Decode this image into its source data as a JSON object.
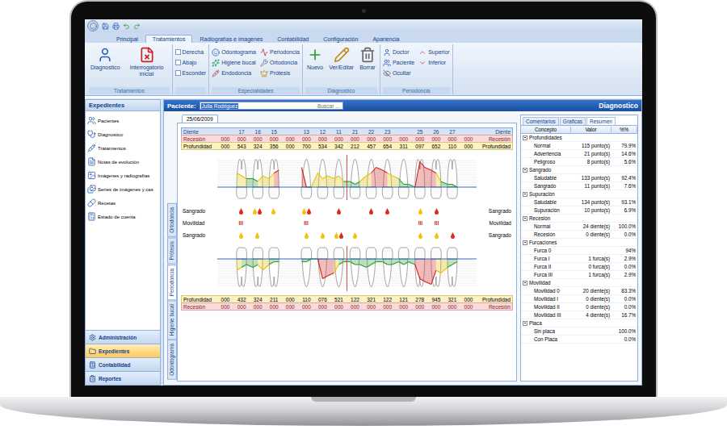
{
  "ribbon": {
    "tabs": [
      {
        "label": "Principal",
        "selected": false
      },
      {
        "label": "Tratamientos",
        "selected": true
      },
      {
        "label": "Radiografías e imágenes",
        "selected": false
      },
      {
        "label": "Contabilidad",
        "selected": false
      },
      {
        "label": "Configuración",
        "selected": false
      },
      {
        "label": "Apariencia",
        "selected": false
      }
    ],
    "groups": [
      {
        "label": "Tratamientos",
        "items": [
          {
            "label": "Diagnostico",
            "kind": "large"
          },
          {
            "label": "Interrogatorio inicial",
            "kind": "large"
          }
        ]
      },
      {
        "items": [
          {
            "label": "Derecha",
            "kind": "checkbox",
            "checked": false
          },
          {
            "label": "Abajo",
            "kind": "checkbox",
            "checked": false
          },
          {
            "label": "Esconder",
            "kind": "checkbox",
            "checked": false
          }
        ]
      },
      {
        "label": "Especialidades",
        "items": [
          {
            "label": "Odontograma",
            "kind": "small"
          },
          {
            "label": "Higiene bucal",
            "kind": "small"
          },
          {
            "label": "Endodoncia",
            "kind": "small"
          },
          {
            "label": "Periodoncia",
            "kind": "small"
          },
          {
            "label": "Ortodoncia",
            "kind": "small"
          },
          {
            "label": "Prótesis",
            "kind": "small"
          }
        ]
      },
      {
        "label": "Diagnostico",
        "items": [
          {
            "label": "Nuevo",
            "kind": "large"
          },
          {
            "label": "Ver/Editar",
            "kind": "large"
          },
          {
            "label": "Borrar",
            "kind": "large"
          }
        ]
      },
      {
        "label": "Periodoncia",
        "items": [
          {
            "label": "Doctor",
            "kind": "small"
          },
          {
            "label": "Paciente",
            "kind": "small"
          },
          {
            "label": "Ocultar",
            "kind": "small"
          },
          {
            "label": "Superior",
            "kind": "small"
          },
          {
            "label": "Inferior",
            "kind": "small"
          }
        ]
      }
    ]
  },
  "sidebar": {
    "title": "Expedientes",
    "items": [
      "Pacientes",
      "Diagnostico",
      "Tratamientos",
      "Notas de evolución",
      "Imágenes y radiografías",
      "Series de imágenes y cas",
      "Recetas",
      "Estado de cuenta"
    ],
    "nav": [
      {
        "label": "Administración",
        "selected": false
      },
      {
        "label": "Expedientes",
        "selected": true
      },
      {
        "label": "Contabilidad",
        "selected": false
      },
      {
        "label": "Reportes",
        "selected": false
      }
    ]
  },
  "patient_bar": {
    "label": "Paciente:",
    "value": "Julia Rodriguez",
    "placeholder": "Buscar ...",
    "title": "Diagnostico"
  },
  "view_tabs": [
    {
      "label": "Ortodoncia",
      "selected": false
    },
    {
      "label": "Prótesis",
      "selected": false
    },
    {
      "label": "Periodoncia",
      "selected": true
    },
    {
      "label": "Higiene bucal",
      "selected": false
    },
    {
      "label": "Odontograma",
      "selected": false
    }
  ],
  "date_tab": {
    "label": "25/06/2009"
  },
  "periodontogram": {
    "tooth_label": "Diente",
    "teeth": [
      "",
      "17",
      "16",
      "15",
      "",
      "13",
      "12",
      "11",
      "21",
      "22",
      "23",
      "",
      "25",
      "26",
      "27",
      ""
    ],
    "upper_recession": {
      "label": "Recesión",
      "values": [
        "000",
        "000",
        "000",
        "000",
        "000",
        "000",
        "000",
        "000",
        "000",
        "000",
        "000",
        "000",
        "000",
        "000",
        "000",
        "000"
      ]
    },
    "upper_depth": {
      "label": "Profundidad",
      "values": [
        "000",
        "543",
        "324",
        "356",
        "000",
        "700",
        "534",
        "342",
        "212",
        "457",
        "654",
        "311",
        "097",
        "652",
        "110",
        "000"
      ]
    },
    "markers": [
      {
        "label": "Sangrado",
        "kind": "drops",
        "cells": [
          {
            "bleeding": false,
            "suppuration": false
          },
          {
            "bleeding": true,
            "suppuration": false
          },
          {
            "bleeding": true,
            "suppuration": true
          },
          {
            "bleeding": false,
            "suppuration": true
          },
          {
            "bleeding": false,
            "suppuration": false
          },
          {
            "bleeding": true,
            "suppuration": true
          },
          {
            "bleeding": false,
            "suppuration": false
          },
          {
            "bleeding": true,
            "suppuration": false
          },
          {
            "bleeding": false,
            "suppuration": false
          },
          {
            "bleeding": true,
            "suppuration": false
          },
          {
            "bleeding": true,
            "suppuration": false
          },
          {
            "bleeding": false,
            "suppuration": false
          },
          {
            "bleeding": false,
            "suppuration": true
          },
          {
            "bleeding": true,
            "suppuration": false
          },
          {
            "bleeding": false,
            "suppuration": false
          },
          {
            "bleeding": false,
            "suppuration": false
          }
        ]
      },
      {
        "label": "Movilidad",
        "kind": "mobility",
        "cells": [
          "",
          "III",
          "",
          "",
          "",
          "III",
          "",
          "",
          "",
          "",
          "",
          "",
          "III",
          "III",
          "",
          ""
        ]
      },
      {
        "label": "Sangrado",
        "kind": "drops",
        "cells": [
          {
            "bleeding": false,
            "suppuration": false
          },
          {
            "bleeding": false,
            "suppuration": true
          },
          {
            "bleeding": false,
            "suppuration": true
          },
          {
            "bleeding": false,
            "suppuration": false
          },
          {
            "bleeding": false,
            "suppuration": false
          },
          {
            "bleeding": false,
            "suppuration": true
          },
          {
            "bleeding": false,
            "suppuration": true
          },
          {
            "bleeding": true,
            "suppuration": true
          },
          {
            "bleeding": false,
            "suppuration": true
          },
          {
            "bleeding": false,
            "suppuration": false
          },
          {
            "bleeding": false,
            "suppuration": false
          },
          {
            "bleeding": false,
            "suppuration": false
          },
          {
            "bleeding": false,
            "suppuration": true
          },
          {
            "bleeding": false,
            "suppuration": true
          },
          {
            "bleeding": true,
            "suppuration": false
          },
          {
            "bleeding": false,
            "suppuration": false
          }
        ]
      }
    ],
    "lower_depth": {
      "label": "Profundidad",
      "values": [
        "000",
        "432",
        "324",
        "211",
        "000",
        "110",
        "076",
        "521",
        "122",
        "321",
        "122",
        "121",
        "278",
        "945",
        "321",
        "000"
      ]
    },
    "lower_recession": {
      "label": "Recesión",
      "values": [
        "000",
        "000",
        "000",
        "000",
        "000",
        "000",
        "000",
        "000",
        "000",
        "000",
        "000",
        "000",
        "000",
        "000",
        "000",
        "000"
      ]
    }
  },
  "summary": {
    "tabs": [
      {
        "label": "Comentarios",
        "selected": false
      },
      {
        "label": "Graficas",
        "selected": false
      },
      {
        "label": "Resumen",
        "selected": true
      }
    ],
    "columns": [
      "Concepto",
      "Valor",
      "%%"
    ],
    "groups": [
      {
        "label": "Profundidades",
        "expanded": true,
        "rows": [
          {
            "concept": "Normal",
            "value": "115 punto(s)",
            "percent": "79.9%"
          },
          {
            "concept": "Advertencia",
            "value": "21 punto(s)",
            "percent": "14.6%"
          },
          {
            "concept": "Peligroso",
            "value": "8 punto(s)",
            "percent": "5.6%"
          }
        ]
      },
      {
        "label": "Sangrado",
        "expanded": true,
        "rows": [
          {
            "concept": "Saludable",
            "value": "133 punto(s)",
            "percent": "92.4%"
          },
          {
            "concept": "Sangrado",
            "value": "11 punto(s)",
            "percent": "7.6%"
          }
        ]
      },
      {
        "label": "Supuración",
        "expanded": true,
        "rows": [
          {
            "concept": "Saludable",
            "value": "134 punto(s)",
            "percent": "93.1%"
          },
          {
            "concept": "Supuración",
            "value": "10 punto(s)",
            "percent": "6.9%"
          }
        ]
      },
      {
        "label": "Recesión",
        "expanded": true,
        "rows": [
          {
            "concept": "Normal",
            "value": "24 diente(s)",
            "percent": "100.0%"
          },
          {
            "concept": "Recesión",
            "value": "0 diente(s)",
            "percent": "0.0%"
          }
        ]
      },
      {
        "label": "Furcaciones",
        "expanded": true,
        "rows": [
          {
            "concept": "Furca 0",
            "value": "",
            "percent": "94%"
          },
          {
            "concept": "Furca I",
            "value": "1 furca(s)",
            "percent": "2.9%"
          },
          {
            "concept": "Furca II",
            "value": "0 furca(s)",
            "percent": "0.0%"
          },
          {
            "concept": "Furca III",
            "value": "1 furca(s)",
            "percent": "2.9%"
          }
        ]
      },
      {
        "label": "Movilidad",
        "expanded": true,
        "rows": [
          {
            "concept": "Movilidad 0",
            "value": "20 diente(s)",
            "percent": "83.3%"
          },
          {
            "concept": "Movilidad I",
            "value": "0 diente(s)",
            "percent": "0.0%"
          },
          {
            "concept": "Movilidad II",
            "value": "0 diente(s)",
            "percent": "0.0%"
          },
          {
            "concept": "Movilidad III",
            "value": "4 diente(s)",
            "percent": "16.7%"
          }
        ]
      },
      {
        "label": "Placa",
        "expanded": true,
        "rows": [
          {
            "concept": "Sin placa",
            "value": "",
            "percent": "100.0%"
          },
          {
            "concept": "Con Placa",
            "value": "",
            "percent": "0.0%"
          }
        ]
      }
    ]
  }
}
